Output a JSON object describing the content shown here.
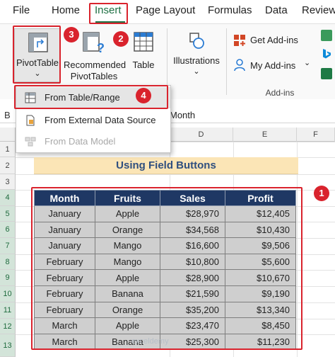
{
  "menu": {
    "file": "File",
    "home": "Home",
    "insert": "Insert",
    "page_layout": "Page Layout",
    "formulas": "Formulas",
    "data": "Data",
    "review": "Review"
  },
  "ribbon": {
    "pivottable": "PivotTable",
    "recommended_line1": "Recommended",
    "recommended_line2": "PivotTables",
    "table": "Table",
    "illustrations": "Illustrations",
    "get_addins": "Get Add-ins",
    "my_addins": "My Add-ins",
    "addins_group": "Add-ins",
    "chevron": "⌄"
  },
  "dropdown": {
    "from_table_range": "From Table/Range",
    "from_external": "From External Data Source",
    "from_data_model": "From Data Model"
  },
  "badges": {
    "b1": "1",
    "b2": "2",
    "b3": "3",
    "b4": "4"
  },
  "formula_bar": {
    "name_box": "B",
    "content": "Month"
  },
  "columns": [
    "D",
    "E",
    "F"
  ],
  "rows": [
    "1",
    "2",
    "3",
    "4",
    "5",
    "6",
    "7",
    "8",
    "9",
    "10",
    "11",
    "12",
    "13"
  ],
  "sheet_title": "Using Field Buttons",
  "table": {
    "headers": [
      "Month",
      "Fruits",
      "Sales",
      "Profit"
    ],
    "rows": [
      [
        "January",
        "Apple",
        "$28,970",
        "$12,405"
      ],
      [
        "January",
        "Orange",
        "$34,568",
        "$10,430"
      ],
      [
        "January",
        "Mango",
        "$16,600",
        "$9,506"
      ],
      [
        "February",
        "Mango",
        "$10,800",
        "$5,600"
      ],
      [
        "February",
        "Apple",
        "$28,900",
        "$10,670"
      ],
      [
        "February",
        "Banana",
        "$21,590",
        "$9,190"
      ],
      [
        "February",
        "Orange",
        "$35,200",
        "$13,340"
      ],
      [
        "March",
        "Apple",
        "$23,470",
        "$8,450"
      ],
      [
        "March",
        "Banana",
        "$25,300",
        "$11,230"
      ]
    ]
  },
  "watermark": "exceldemy"
}
